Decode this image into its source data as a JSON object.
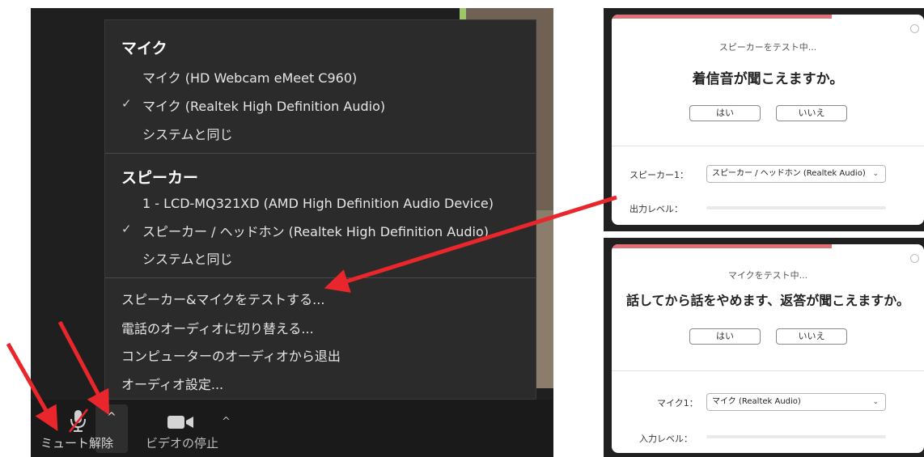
{
  "audio_menu": {
    "microphone": {
      "heading": "マイク",
      "items": [
        {
          "label": "マイク (HD Webcam eMeet C960)",
          "checked": false
        },
        {
          "label": "マイク (Realtek High Definition Audio)",
          "checked": true
        },
        {
          "label": "システムと同じ",
          "checked": false
        }
      ]
    },
    "speaker": {
      "heading": "スピーカー",
      "items": [
        {
          "label": "1 - LCD-MQ321XD (AMD High Definition Audio Device)",
          "checked": false
        },
        {
          "label": "スピーカー / ヘッドホン (Realtek High Definition Audio)",
          "checked": true
        },
        {
          "label": "システムと同じ",
          "checked": false
        }
      ]
    },
    "actions": [
      "スピーカー&マイクをテストする...",
      "電話のオーディオに切り替える...",
      "コンピューターのオーディオから退出",
      "オーディオ設定..."
    ],
    "check_glyph": "✓"
  },
  "toolbar": {
    "mute_label": "ミュート解除",
    "video_label": "ビデオの停止",
    "chevron": "^"
  },
  "speaker_test": {
    "status": "スピーカーをテスト中...",
    "question": "着信音が聞こえますか。",
    "yes": "はい",
    "no": "いいえ",
    "device_label": "スピーカー1：",
    "device_value": "スピーカー / ヘッドホン (Realtek Audio)",
    "level_label": "出力レベル："
  },
  "mic_test": {
    "status": "マイクをテスト中...",
    "question": "話してから話をやめます、返答が聞こえますか。",
    "yes": "はい",
    "no": "いいえ",
    "device_label": "マイク1：",
    "device_value": "マイク (Realtek Audio)",
    "level_label": "入力レベル："
  },
  "colors": {
    "annotation_arrow": "#e8262b",
    "menu_bg": "#2b2b2b",
    "dialog_accent": "#e07077"
  }
}
